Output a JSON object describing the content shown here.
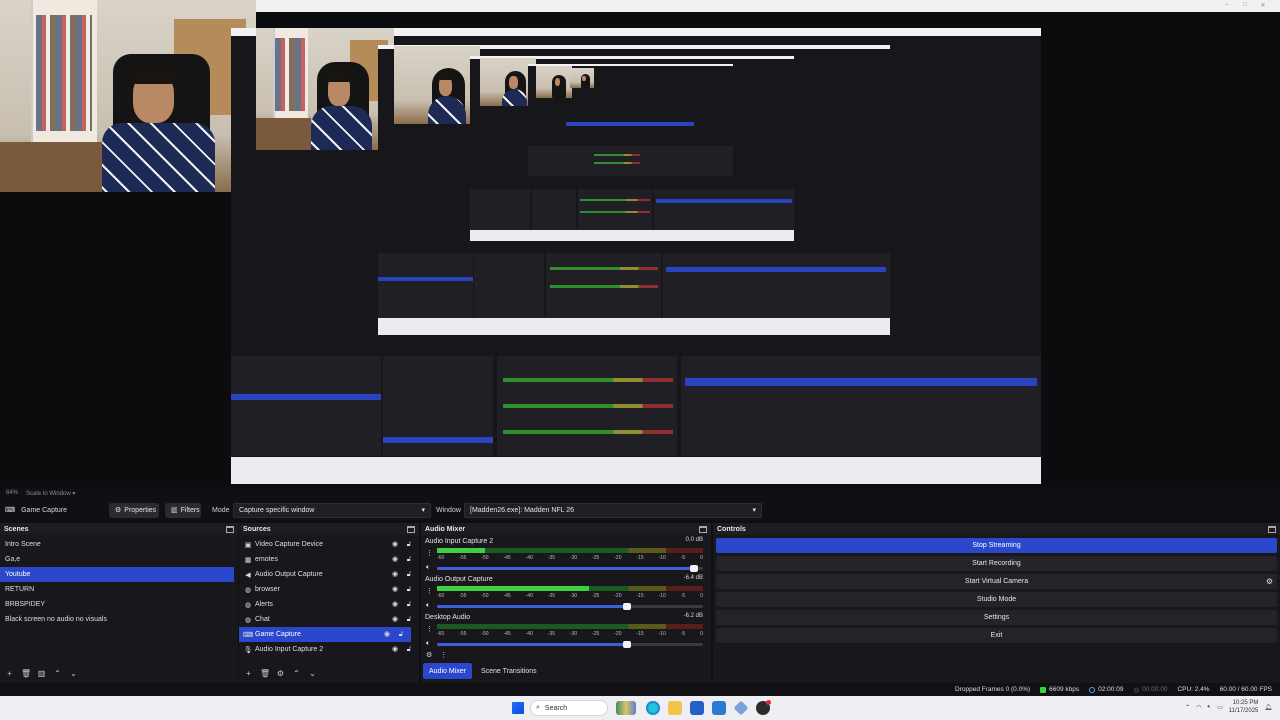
{
  "preview": {
    "scale_label": "84%",
    "scale_option": "Scale to Window"
  },
  "context_bar": {
    "source_name": "Game Capture",
    "properties_label": "Properties",
    "filters_label": "Filters",
    "mode_label": "Mode",
    "mode_value": "Capture specific window",
    "window_label": "Window",
    "window_value": "[Madden26.exe]: Madden NFL 26"
  },
  "scenes": {
    "title": "Scenes",
    "items": [
      {
        "label": "Intro Scene",
        "selected": false
      },
      {
        "label": "Ga,e",
        "selected": false
      },
      {
        "label": "Youtube",
        "selected": true
      },
      {
        "label": "RETURN",
        "selected": false
      },
      {
        "label": "BRBSPIDEY",
        "selected": false
      },
      {
        "label": "Black screen no audio no visuals",
        "selected": false
      }
    ]
  },
  "sources": {
    "title": "Sources",
    "items": [
      {
        "label": "Video Capture Device",
        "icon": "camera-icon",
        "selected": false
      },
      {
        "label": "emotes",
        "icon": "image-icon",
        "selected": false
      },
      {
        "label": "Audio Output Capture",
        "icon": "speaker-icon",
        "selected": false
      },
      {
        "label": "browser",
        "icon": "globe-icon",
        "selected": false
      },
      {
        "label": "Alerts",
        "icon": "globe-icon",
        "selected": false
      },
      {
        "label": "Chat",
        "icon": "globe-icon",
        "selected": false
      },
      {
        "label": "Game Capture",
        "icon": "gamepad-icon",
        "selected": true
      },
      {
        "label": "Audio Input Capture 2",
        "icon": "mic-icon",
        "selected": false
      }
    ]
  },
  "mixer": {
    "title": "Audio Mixer",
    "scale": [
      "-60",
      "-55",
      "-50",
      "-45",
      "-40",
      "-35",
      "-30",
      "-25",
      "-20",
      "-15",
      "-10",
      "-5",
      "0"
    ],
    "channels": [
      {
        "name": "Audio Input Capture 2",
        "db": "0.0 dB",
        "level": 0.18,
        "fader": 0.98
      },
      {
        "name": "Audio Output Capture",
        "db": "-6.4 dB",
        "level": 0.57,
        "fader": 0.73
      },
      {
        "name": "Desktop Audio",
        "db": "-6.2 dB",
        "level": 0.0,
        "fader": 0.73
      }
    ],
    "tab_mixer": "Audio Mixer",
    "tab_transitions": "Scene Transitions"
  },
  "controls": {
    "title": "Controls",
    "stop_streaming": "Stop Streaming",
    "start_recording": "Start Recording",
    "start_virtual_camera": "Start Virtual Camera",
    "studio_mode": "Studio Mode",
    "settings": "Settings",
    "exit": "Exit"
  },
  "status": {
    "dropped_frames": "Dropped Frames 0 (0.0%)",
    "bitrate": "6609 kbps",
    "stream_time": "02:00:09",
    "rec_time": "00:00:00",
    "cpu": "CPU: 2.4%",
    "fps": "60.00 / 60.00 FPS"
  },
  "taskbar": {
    "search_placeholder": "Search",
    "time": "10:25 PM",
    "date": "11/17/2025"
  },
  "colors": {
    "accent": "#2b48cc",
    "dock_bg": "#18181c",
    "meter_green": "#3ed03e"
  }
}
